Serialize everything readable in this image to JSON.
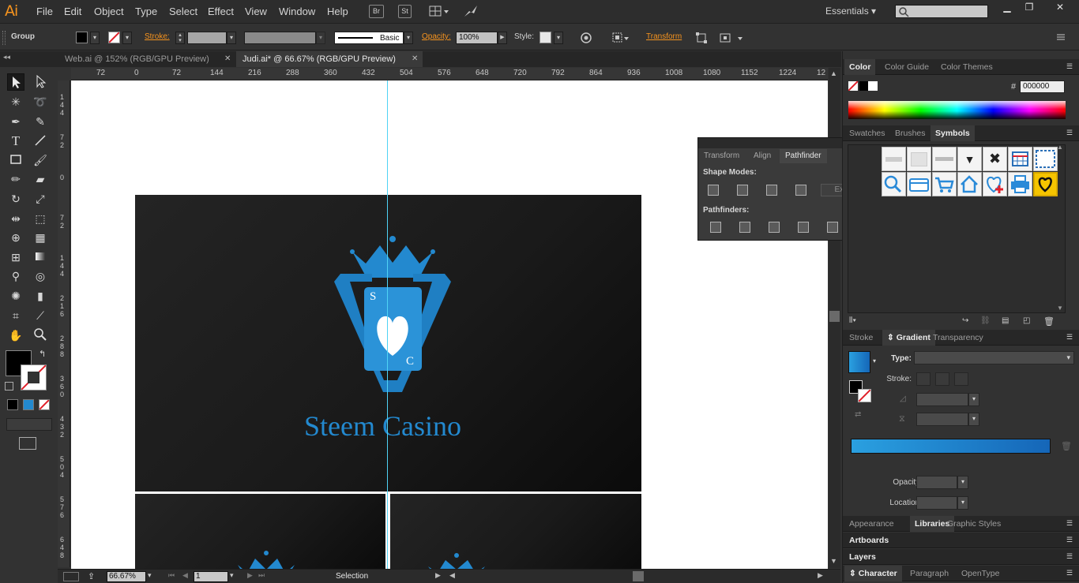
{
  "app": {
    "logo": "Ai"
  },
  "menu": [
    "File",
    "Edit",
    "Object",
    "Type",
    "Select",
    "Effect",
    "View",
    "Window",
    "Help"
  ],
  "menu_icons": {
    "bridge": "Br",
    "stock": "St"
  },
  "workspace": "Essentials",
  "window_controls": {
    "minimize": "▁",
    "restore": "❐",
    "close": "✕"
  },
  "control_bar": {
    "selection_type": "Group",
    "stroke_label": "Stroke:",
    "brush_label": "Basic",
    "opacity_label": "Opacity:",
    "opacity_value": "100%",
    "style_label": "Style:",
    "transform_label": "Transform"
  },
  "documents": [
    {
      "name": "Web.ai @ 152% (RGB/GPU Preview)",
      "active": false
    },
    {
      "name": "Judi.ai* @ 66.67% (RGB/GPU Preview)",
      "active": true
    }
  ],
  "ruler_top": [
    "72",
    "0",
    "72",
    "144",
    "216",
    "288",
    "360",
    "432",
    "504",
    "576",
    "648",
    "720",
    "792",
    "864",
    "936",
    "1008",
    "1080",
    "1152",
    "1224",
    "12"
  ],
  "ruler_left": [
    "144",
    "72",
    "0",
    "72",
    "144",
    "216",
    "288",
    "360",
    "432",
    "504",
    "576",
    "648"
  ],
  "artwork": {
    "brand": "Steem Casino",
    "card_letter_top": "S",
    "card_letter_bottom": "C"
  },
  "status_bar": {
    "zoom": "66.67%",
    "artboard_number": "1",
    "tool": "Selection"
  },
  "pathfinder_panel": {
    "tabs": [
      "Transform",
      "Align",
      "Pathfinder"
    ],
    "active_tab": "Pathfinder",
    "shape_modes_label": "Shape Modes:",
    "pathfinders_label": "Pathfinders:",
    "expand_label": "Expand"
  },
  "color_panel": {
    "tabs": [
      "Color",
      "Color Guide",
      "Color Themes"
    ],
    "hex_label": "#",
    "hex_value": "000000"
  },
  "symbols_panel": {
    "tabs": [
      "Swatches",
      "Brushes",
      "Symbols"
    ]
  },
  "gradient_panel": {
    "tabs": [
      "Stroke",
      "Gradient",
      "Transparency"
    ],
    "type_label": "Type:",
    "stroke_label": "Stroke:",
    "opacity_label": "Opacity:",
    "location_label": "Location:"
  },
  "bottom_panels": {
    "appearance_tabs": [
      "Appearance",
      "Libraries",
      "Graphic Styles"
    ],
    "artboards": "Artboards",
    "layers": "Layers",
    "character_tabs": [
      "Character",
      "Paragraph",
      "OpenType"
    ]
  },
  "colors": {
    "accent_orange": "#f7941e",
    "brand_blue": "#2389cf",
    "guide_cyan": "#4fd3f5"
  }
}
